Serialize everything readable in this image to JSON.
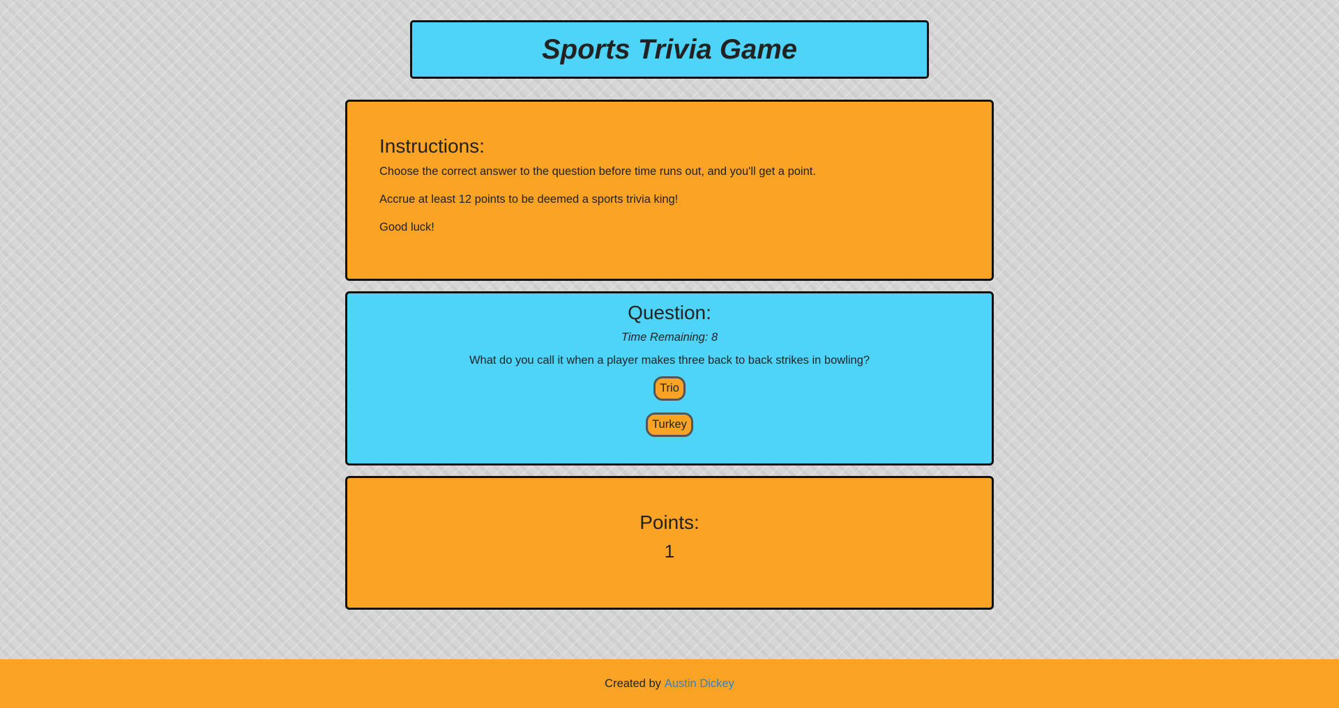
{
  "header": {
    "title": "Sports Trivia Game"
  },
  "instructions": {
    "heading": "Instructions:",
    "lines": [
      "Choose the correct answer to the question before time runs out, and you'll get a point.",
      "Accrue at least 12 points to be deemed a sports trivia king!",
      "Good luck!"
    ]
  },
  "question": {
    "heading": "Question:",
    "time_remaining": "Time Remaining: 8",
    "text": "What do you call it when a player makes three back to back strikes in bowling?",
    "answers": [
      "Trio",
      "Turkey"
    ]
  },
  "points": {
    "heading": "Points:",
    "value": "1"
  },
  "footer": {
    "prefix": "Created by",
    "author_link": "Austin Dickey"
  },
  "colors": {
    "orange": "#fba324",
    "blue": "#4dd4f8",
    "link": "#2a82d6",
    "border": "#111111"
  }
}
